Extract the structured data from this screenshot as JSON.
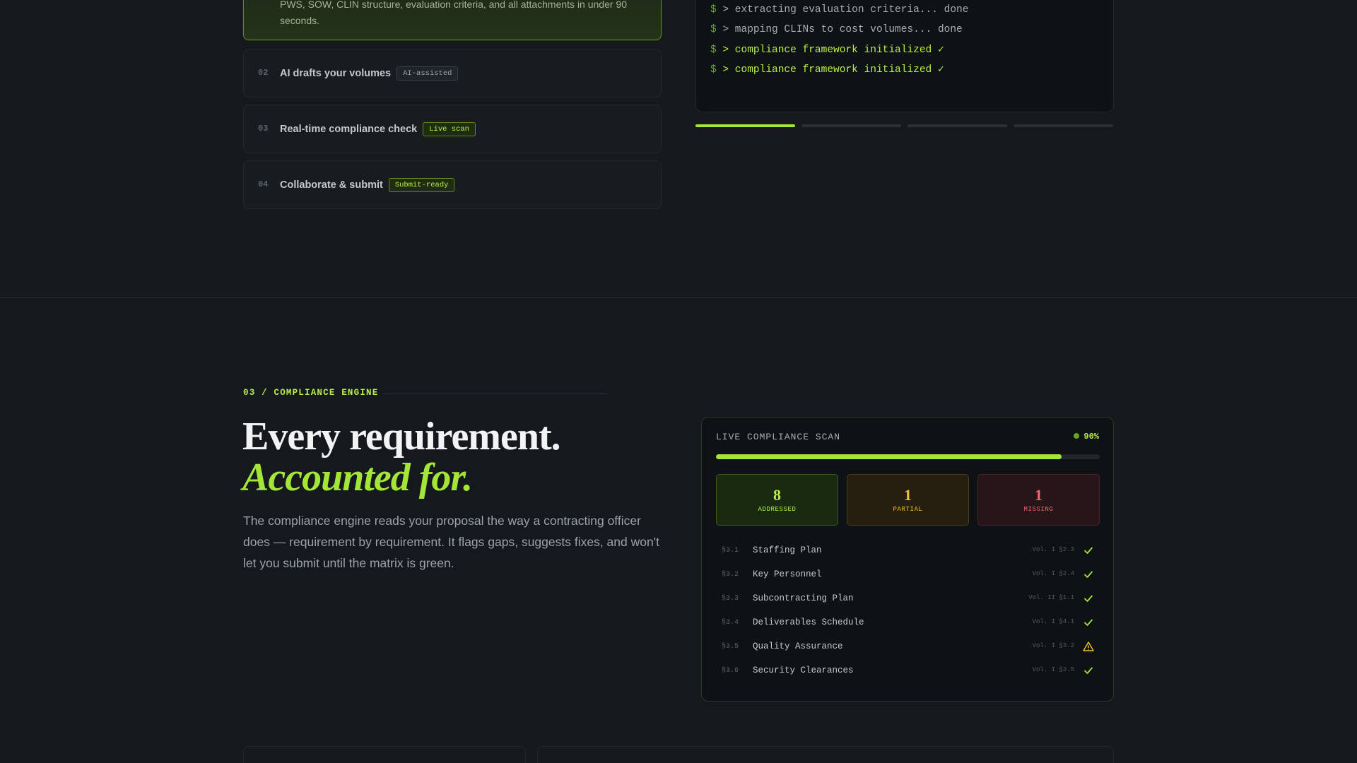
{
  "steps": {
    "active_desc": "PWS, SOW, CLIN structure, evaluation criteria, and all attachments in under 90 seconds.",
    "items": [
      {
        "num": "02",
        "title": "AI drafts your volumes",
        "badge": "AI-assisted"
      },
      {
        "num": "03",
        "title": "Real-time compliance check",
        "badge": "Live scan"
      },
      {
        "num": "04",
        "title": "Collaborate & submit",
        "badge": "Submit-ready"
      }
    ]
  },
  "terminal": {
    "prompt": "$",
    "lines": [
      "> extracting evaluation criteria... done",
      "> mapping CLINs to cost volumes... done",
      "> compliance framework initialized ✓",
      "> compliance framework initialized ✓"
    ]
  },
  "progress": {
    "active_index": 0,
    "segments": 4
  },
  "compliance": {
    "eyebrow": "03 / COMPLIANCE ENGINE",
    "heading_line1": "Every requirement.",
    "heading_line2": "Accounted for.",
    "lead": "The compliance engine reads your proposal the way a contracting officer does — requirement by requirement. It flags gaps, suggests fixes, and won't let you submit until the matrix is green."
  },
  "scan": {
    "title": "LIVE COMPLIANCE SCAN",
    "percent_label": "90%",
    "progress_fraction": 0.9,
    "stats": {
      "addressed": {
        "value": "8",
        "label": "ADDRESSED"
      },
      "partial": {
        "value": "1",
        "label": "PARTIAL"
      },
      "missing": {
        "value": "1",
        "label": "MISSING"
      }
    },
    "requirements": [
      {
        "id": "§3.1",
        "name": "Staffing Plan",
        "ref": "Vol. I §2.3",
        "status": "check-icon"
      },
      {
        "id": "§3.2",
        "name": "Key Personnel",
        "ref": "Vol. I §2.4",
        "status": "check-icon"
      },
      {
        "id": "§3.3",
        "name": "Subcontracting Plan",
        "ref": "Vol. II §1.1",
        "status": "check-icon"
      },
      {
        "id": "§3.4",
        "name": "Deliverables Schedule",
        "ref": "Vol. I §4.1",
        "status": "check-icon"
      },
      {
        "id": "§3.5",
        "name": "Quality Assurance",
        "ref": "Vol. I §3.2",
        "status": "warning-icon"
      },
      {
        "id": "§3.6",
        "name": "Security Clearances",
        "ref": "Vol. I §2.5",
        "status": "check-icon"
      }
    ]
  },
  "colors": {
    "accent": "#a3e635",
    "warning": "#f0c23a",
    "danger": "#ef6b6b"
  }
}
